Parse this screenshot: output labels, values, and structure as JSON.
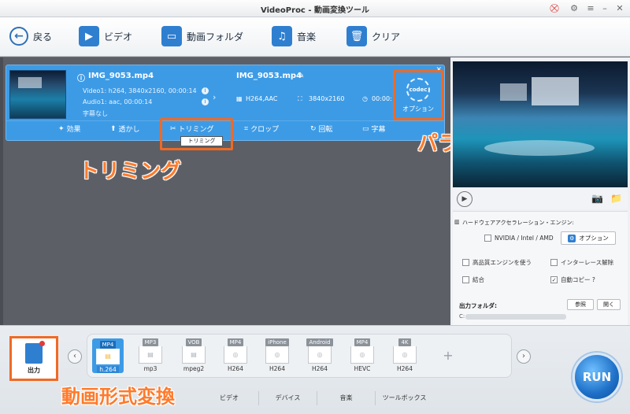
{
  "window": {
    "title": "VideoProc - 動画変換ツール",
    "icons": [
      "cart-icon",
      "gear-icon",
      "menu-icon",
      "minimize-icon",
      "close-icon"
    ]
  },
  "toolbar": {
    "back": "戻る",
    "video": "ビデオ",
    "folder": "動画フォルダ",
    "music": "音楽",
    "clear": "クリア"
  },
  "item": {
    "source_name": "IMG_9053.mp4",
    "video_track": "Video1: h264, 3840x2160, 00:00:14",
    "audio_track": "Audio1: aac, 00:00:14",
    "subtitle": "字幕なし",
    "output_name": "IMG_9053.mp4",
    "output_codec": "H264,AAC",
    "output_res": "3840x2160",
    "output_time": "00:00:",
    "codec_badge": "codec",
    "codec_label": "オプション",
    "actions": {
      "effect": "効果",
      "watermark": "透かし",
      "trim": "トリミング",
      "crop": "クロップ",
      "rotate": "回転",
      "subtitle": "字幕"
    },
    "trim_tooltip": "トリミング"
  },
  "annotations": {
    "trim": "トリミング",
    "params": "パラメーター調整",
    "format": "動画形式変換"
  },
  "hardware": {
    "title": "ハードウェアアクセラレーション・エンジン:",
    "gpu_label": "NVIDIA / Intel / AMD",
    "option_button": "オプション",
    "high_quality": "高品質エンジンを使う",
    "deinterlace": "インターレース解除",
    "merge": "結合",
    "auto_copy": "自動コピー ?"
  },
  "output_folder": {
    "label": "出力フォルダ:",
    "path_prefix": "C:",
    "browse": "参照",
    "open": "開く"
  },
  "output_button": "出力",
  "formats": [
    {
      "tag": "MP4",
      "name": "h.264",
      "selected": true
    },
    {
      "tag": "MP3",
      "name": "mp3",
      "selected": false
    },
    {
      "tag": "VOB",
      "name": "mpeg2",
      "selected": false
    },
    {
      "tag": "MP4",
      "name": "H264",
      "selected": false
    },
    {
      "tag": "iPhone",
      "name": "H264",
      "selected": false
    },
    {
      "tag": "Android",
      "name": "H264",
      "selected": false
    },
    {
      "tag": "MP4",
      "name": "HEVC",
      "selected": false
    },
    {
      "tag": "4K",
      "name": "H264",
      "selected": false
    }
  ],
  "categories": [
    "ビデオ",
    "デバイス",
    "音楽",
    "ツールボックス"
  ],
  "run_label": "RUN",
  "colors": {
    "accent": "#3d9be6",
    "highlight": "#ef6a25",
    "annotation": "#ff7a2a"
  }
}
